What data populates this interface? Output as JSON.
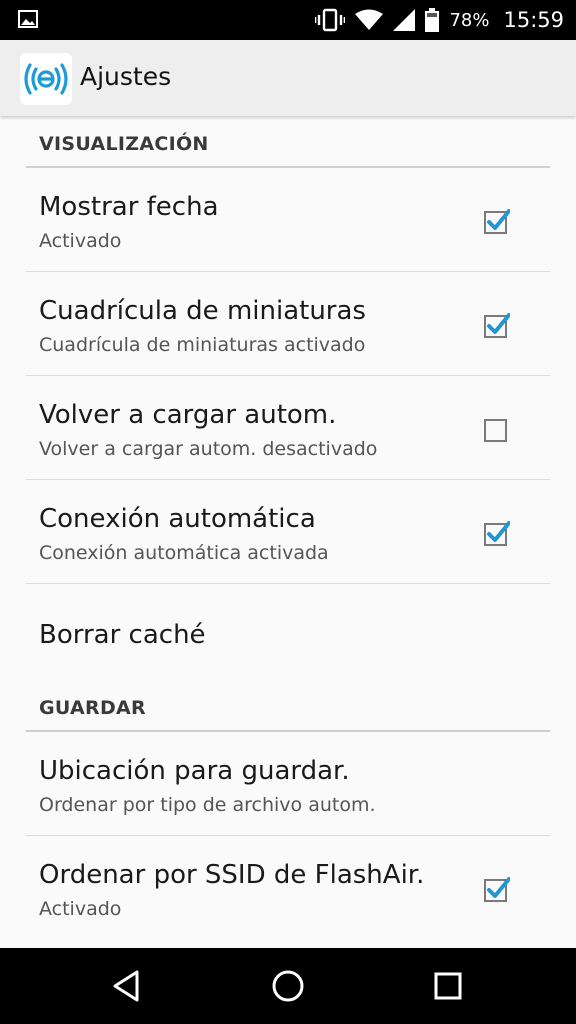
{
  "status_bar": {
    "battery_percent": "78%",
    "time": "15:59",
    "icons": [
      "gallery-icon",
      "vibrate-icon",
      "wifi-icon",
      "signal-icon",
      "battery-icon"
    ]
  },
  "app_bar": {
    "title": "Ajustes",
    "logo_icon": "flashair-icon"
  },
  "sections": {
    "display": {
      "header": "VISUALIZACIÓN",
      "items": [
        {
          "title": "Mostrar fecha",
          "summary": "Activado",
          "checked": true
        },
        {
          "title": "Cuadrícula de miniaturas",
          "summary": "Cuadrícula de miniaturas activado",
          "checked": true
        },
        {
          "title": "Volver a cargar autom.",
          "summary": "Volver a cargar autom. desactivado",
          "checked": false
        },
        {
          "title": "Conexión automática",
          "summary": "Conexión automática activada",
          "checked": true
        },
        {
          "title": "Borrar caché"
        }
      ]
    },
    "save": {
      "header": "GUARDAR",
      "items": [
        {
          "title": "Ubicación para guardar.",
          "summary": "Ordenar por tipo de archivo autom."
        },
        {
          "title": "Ordenar por SSID de FlashAir.",
          "summary": "Activado",
          "checked": true
        }
      ]
    }
  },
  "colors": {
    "accent": "#2196d3",
    "checkbox_border": "#7a7a7a"
  },
  "nav_bar": {
    "icons": [
      "back-icon",
      "home-icon",
      "recents-icon"
    ]
  }
}
